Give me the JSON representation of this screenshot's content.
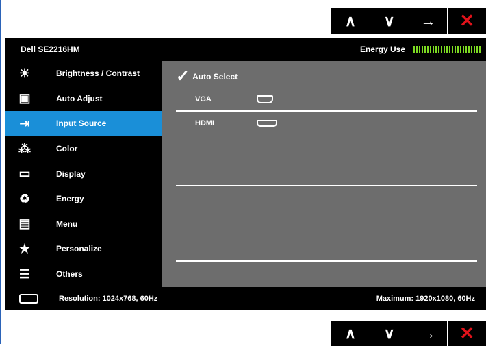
{
  "navigation": {
    "up_icon": "∧",
    "down_icon": "∨",
    "right_icon": "→",
    "close_icon": "✕"
  },
  "header": {
    "model": "Dell SE2216HM",
    "energy_label": "Energy Use",
    "energy_color": "#7ddb22"
  },
  "menu": {
    "items": [
      {
        "label": "Brightness / Contrast",
        "icon": "brightness-icon"
      },
      {
        "label": "Auto Adjust",
        "icon": "auto-adjust-icon"
      },
      {
        "label": "Input Source",
        "icon": "input-source-icon",
        "selected": true
      },
      {
        "label": "Color",
        "icon": "color-icon"
      },
      {
        "label": "Display",
        "icon": "display-icon"
      },
      {
        "label": "Energy",
        "icon": "energy-icon"
      },
      {
        "label": "Menu",
        "icon": "menu-icon"
      },
      {
        "label": "Personalize",
        "icon": "star-icon"
      },
      {
        "label": "Others",
        "icon": "sliders-icon"
      }
    ],
    "selected_color": "#1a8fd8"
  },
  "input_source": {
    "auto_select": "Auto Select",
    "vga": "VGA",
    "hdmi": "HDMI"
  },
  "footer": {
    "resolution": "Resolution: 1024x768, 60Hz",
    "maximum": "Maximum: 1920x1080, 60Hz"
  },
  "colors": {
    "panel": "#6d6d6d",
    "close": "#e0121a"
  }
}
